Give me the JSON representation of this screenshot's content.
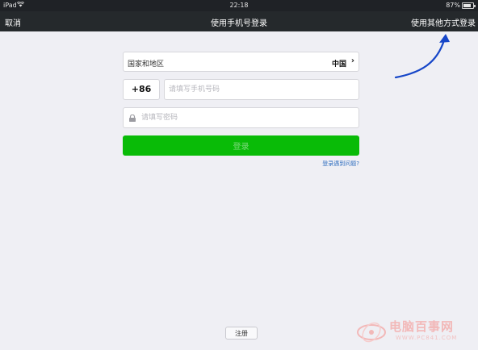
{
  "status_bar": {
    "device": "iPad",
    "time": "22:18",
    "battery": "87%"
  },
  "nav": {
    "cancel": "取消",
    "title": "使用手机号登录",
    "other_login": "使用其他方式登录"
  },
  "form": {
    "country_label": "国家和地区",
    "country_value": "中国",
    "country_code": "+86",
    "phone_placeholder": "请填写手机号码",
    "password_placeholder": "请填写密码",
    "login_button": "登录",
    "help_link": "登录遇到问题?"
  },
  "footer": {
    "register": "注册"
  },
  "watermark": {
    "text": "电脑百事网",
    "url": "WWW.PC841.COM"
  },
  "colors": {
    "nav_bg": "#25292c",
    "page_bg": "#efeff4",
    "primary_green": "#09bb07",
    "link_blue": "#2f6ebf",
    "annotation_arrow": "#1646c8"
  },
  "icons": [
    "wifi-icon",
    "battery-icon",
    "chevron-right-icon",
    "lock-icon",
    "annotation-arrow",
    "watermark-logo-icon"
  ]
}
